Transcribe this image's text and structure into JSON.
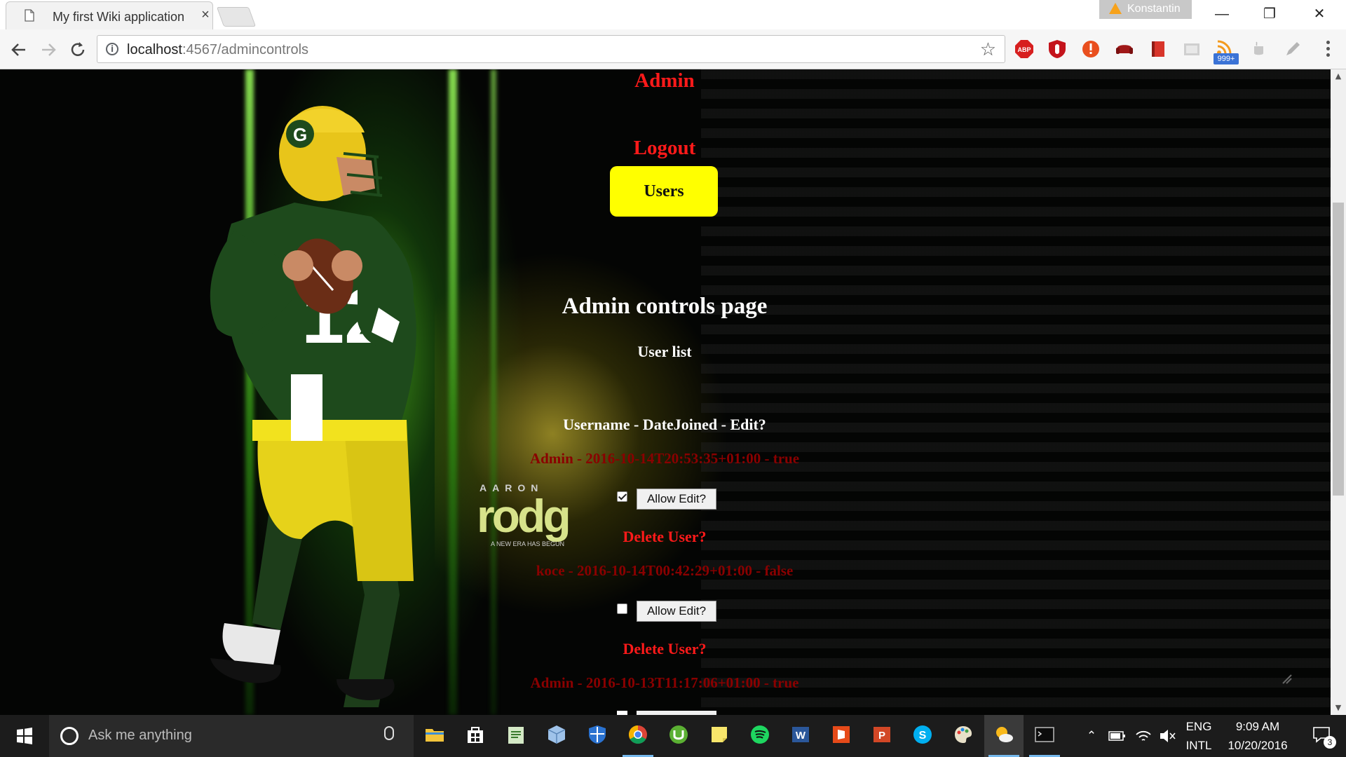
{
  "browser": {
    "tab_title": "My first Wiki application",
    "tab_close": "×",
    "profile_name": "Konstantin",
    "url_host": "localhost",
    "url_rest": ":4567/admincontrols",
    "ext_badge": "999+",
    "window_controls": {
      "minimize": "—",
      "restore": "❐",
      "close": "✕"
    }
  },
  "page": {
    "admin_link": "Admin",
    "logout_link": "Logout",
    "users_button": "Users",
    "title": "Admin controls page",
    "subtitle": "User list",
    "column_header": "Username - DateJoined - Edit?",
    "users": [
      {
        "line": "Admin - 2016-10-14T20:53:35+01:00 - true",
        "checked": true,
        "allow_edit": "Allow Edit?",
        "delete": "Delete User?"
      },
      {
        "line": "koce - 2016-10-14T00:42:29+01:00 - false",
        "checked": false,
        "allow_edit": "Allow Edit?",
        "delete": "Delete User?"
      },
      {
        "line": "Admin - 2016-10-13T11:17:06+01:00 - true"
      }
    ],
    "background_brand": "AARON rodgers — A NEW ERA HAS BEGUN"
  },
  "taskbar": {
    "search_placeholder": "Ask me anything",
    "apps": [
      "file-explorer",
      "store",
      "notepad",
      "virtualbox",
      "defender",
      "chrome",
      "utorrent",
      "sticky-notes",
      "spotify",
      "word",
      "office",
      "powerpoint",
      "skype",
      "paint",
      "weather",
      "terminal"
    ],
    "lang_top": "ENG",
    "lang_bottom": "INTL",
    "time": "9:09 AM",
    "date": "10/20/2016",
    "notifications": "3"
  },
  "colors": {
    "link_red": "#ff1a1a",
    "entry_darkred": "#8a0000",
    "users_button_bg": "#ffff00",
    "taskbar_bg": "#1c1c1c"
  }
}
